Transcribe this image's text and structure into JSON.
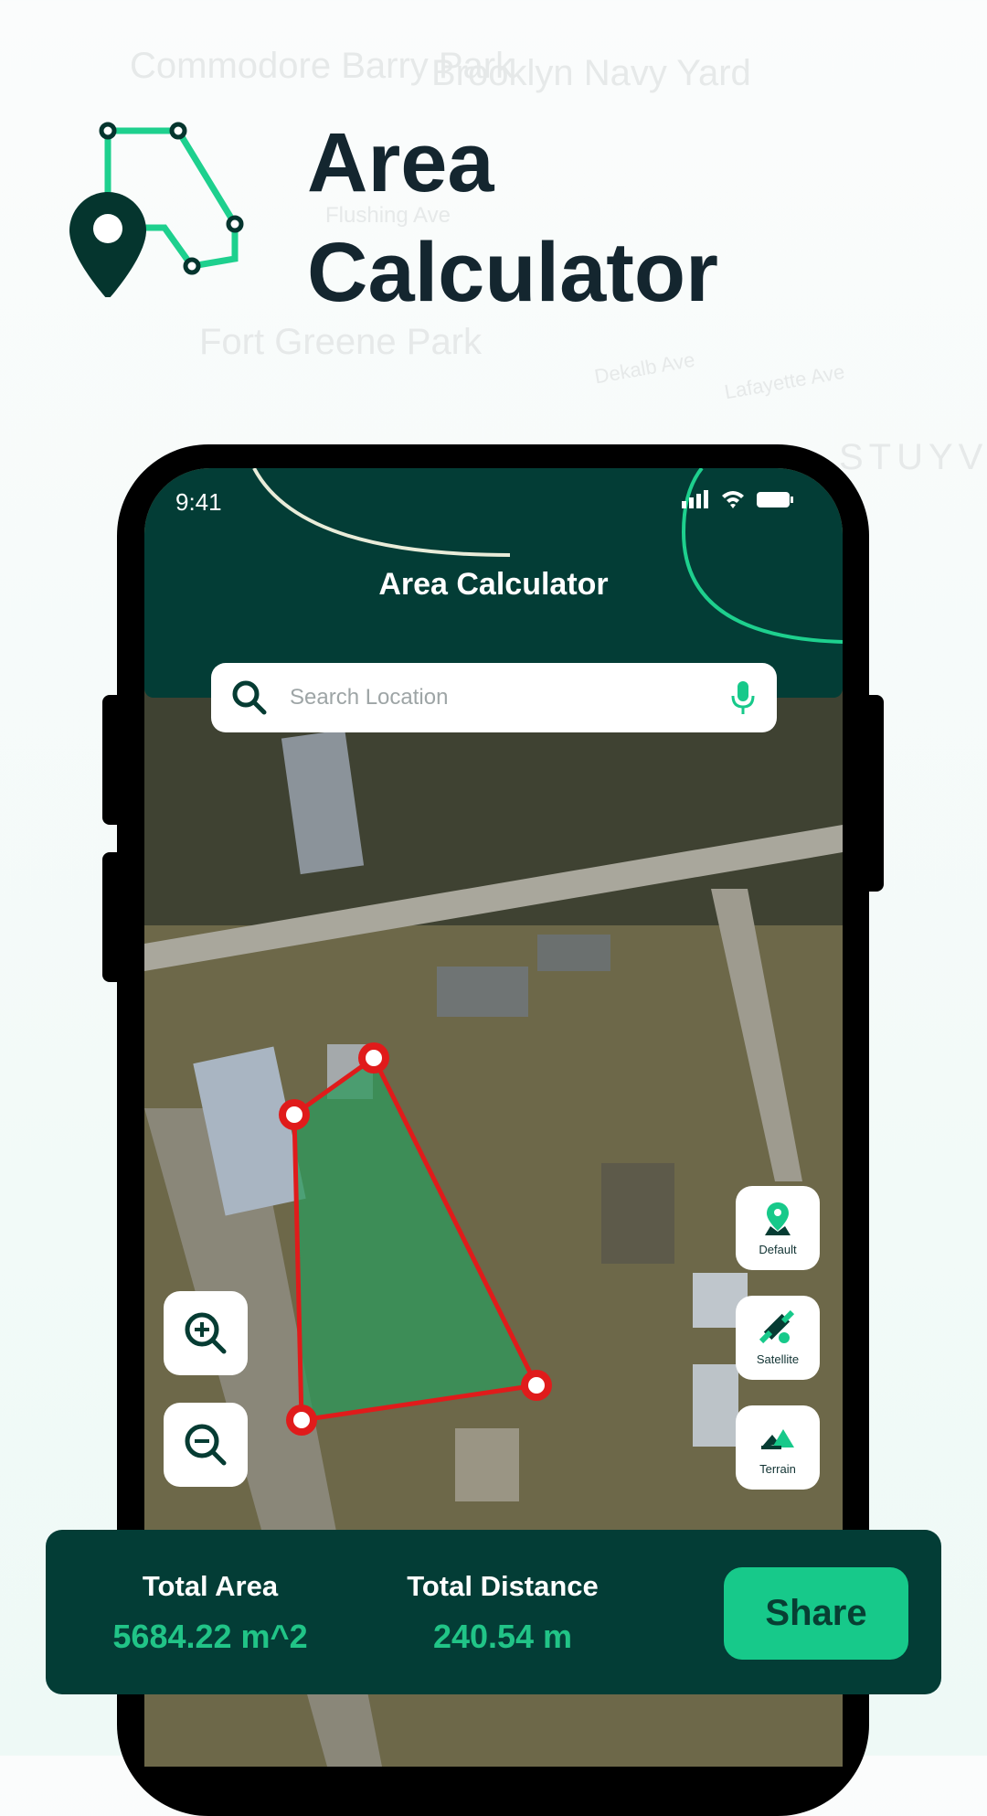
{
  "background_labels": [
    "Commodore Barry Park",
    "Brooklyn Navy Yard",
    "Fort Greene Park",
    "Flushing Ave",
    "Dekalb Ave",
    "Lafayette Ave",
    "STUYVE"
  ],
  "hero": {
    "title_line1": "Area",
    "title_line2": "Calculator"
  },
  "status_bar": {
    "time": "9:41"
  },
  "app": {
    "title": "Area Calculator"
  },
  "search": {
    "placeholder": "Search Location",
    "value": ""
  },
  "map_types": [
    {
      "label": "Default",
      "icon": "map-pin-icon"
    },
    {
      "label": "Satellite",
      "icon": "satellite-icon"
    },
    {
      "label": "Terrain",
      "icon": "mountain-icon"
    }
  ],
  "zoom": {
    "in_icon": "zoom-in-icon",
    "out_icon": "zoom-out-icon"
  },
  "summary": {
    "area_label": "Total Area",
    "area_value": "5684.22 m^2",
    "distance_label": "Total Distance",
    "distance_value": "240.54 m",
    "share_label": "Share"
  },
  "colors": {
    "primary": "#033d36",
    "accent": "#17c98a",
    "polygon": "#e01b1b"
  }
}
